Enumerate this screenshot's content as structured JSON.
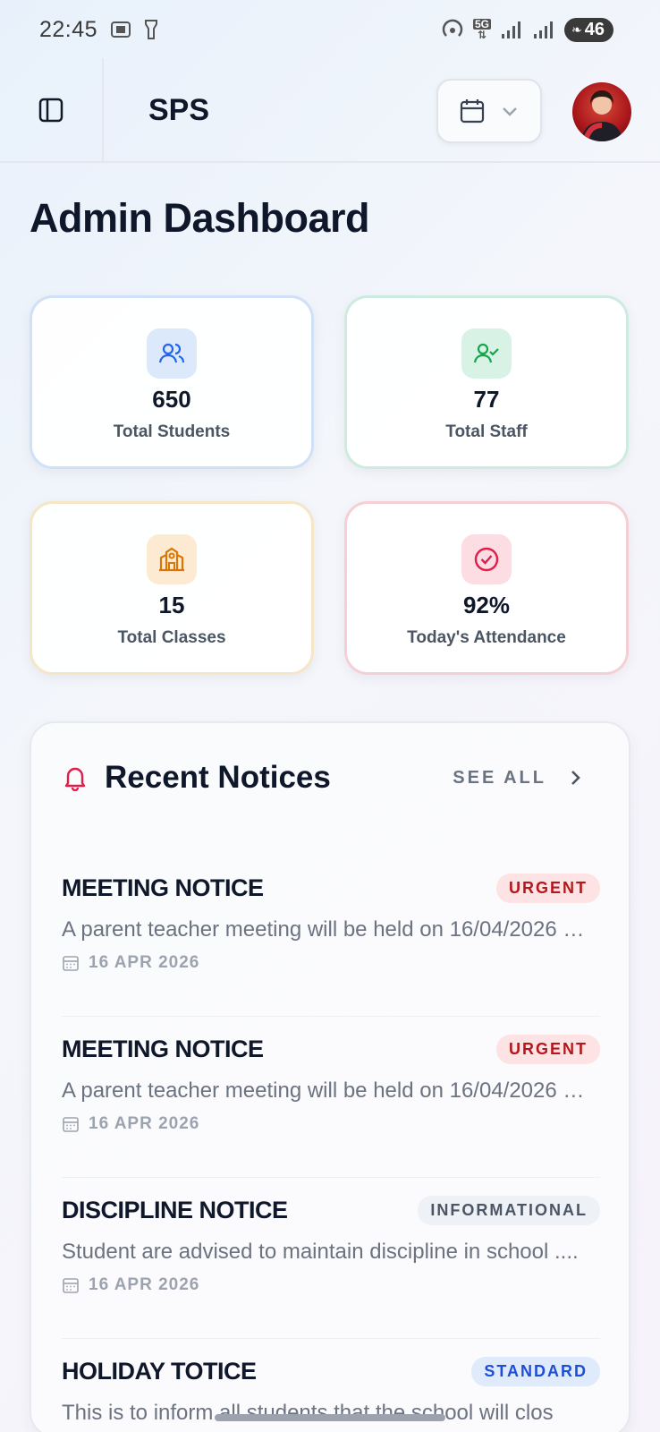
{
  "status_bar": {
    "time": "22:45",
    "battery": "46",
    "network": "5G"
  },
  "header": {
    "app_title": "SPS"
  },
  "page": {
    "title": "Admin Dashboard"
  },
  "stats": [
    {
      "value": "650",
      "label": "Total Students",
      "icon": "users-icon",
      "color": "#2563eb"
    },
    {
      "value": "77",
      "label": "Total Staff",
      "icon": "user-check-icon",
      "color": "#16a34a"
    },
    {
      "value": "15",
      "label": "Total Classes",
      "icon": "school-icon",
      "color": "#d97706"
    },
    {
      "value": "92%",
      "label": "Today's Attendance",
      "icon": "check-circle-icon",
      "color": "#e11d48"
    }
  ],
  "notices": {
    "title": "Recent Notices",
    "see_all": "SEE ALL",
    "items": [
      {
        "title": "MEETING NOTICE",
        "badge": "URGENT",
        "body": "A parent teacher meeting will be held on 16/04/2026 …",
        "date": "16 APR 2026"
      },
      {
        "title": "MEETING NOTICE",
        "badge": "URGENT",
        "body": "A parent teacher meeting will be held on 16/04/2026 …",
        "date": "16 APR 2026"
      },
      {
        "title": "DISCIPLINE NOTICE",
        "badge": "INFORMATIONAL",
        "body": "Student are advised to maintain discipline in school ....",
        "date": "16 APR 2026"
      },
      {
        "title": "HOLIDAY TOTICE",
        "badge": "STANDARD",
        "body": "This is to inform all students that the school will clos",
        "date": ""
      }
    ]
  }
}
